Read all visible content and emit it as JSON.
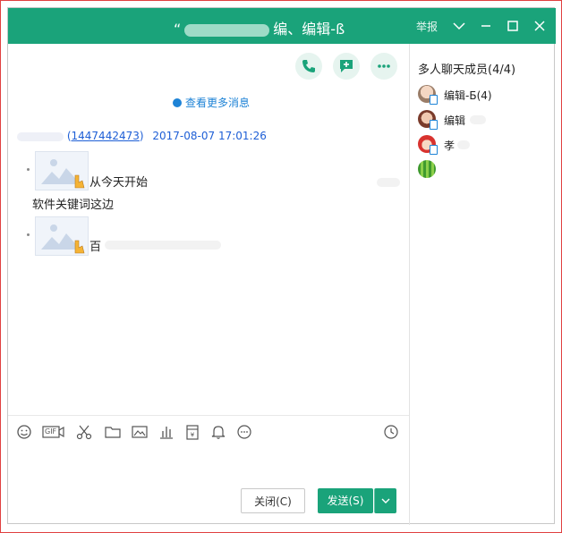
{
  "window": {
    "title_prefix": "“",
    "title_suffix": "编、编辑-ß",
    "report_label": "举报",
    "colors": {
      "titlebar": "#1aa37a",
      "link": "#1e5fd6",
      "accent": "#1e83d6"
    }
  },
  "chat": {
    "more_messages": "查看更多消息",
    "sender": {
      "qq_open": "(",
      "qq_id": "1447442473",
      "qq_close": ")",
      "timestamp": "2017-08-07 17:01:26"
    },
    "messages": [
      {
        "text": "从今天开始"
      },
      {
        "text": "软件关键词这边"
      },
      {
        "text": "百"
      }
    ]
  },
  "toolbar": {
    "icons": [
      "emoji-icon",
      "gif-icon",
      "scissors-icon",
      "folder-icon",
      "image-icon",
      "chart-icon",
      "red-packet-icon",
      "bell-icon",
      "more-icon",
      "history-icon"
    ],
    "gif_label": "GIF"
  },
  "buttons": {
    "close_label": "关闭(C)",
    "send_label": "发送(S)",
    "send_dropdown": "⌵"
  },
  "members": {
    "title": "多人聊天成员(4/4)",
    "list": [
      {
        "name": "编辑-Б(4)"
      },
      {
        "name": "编辑"
      },
      {
        "name": "孝"
      },
      {
        "name": ""
      }
    ]
  }
}
